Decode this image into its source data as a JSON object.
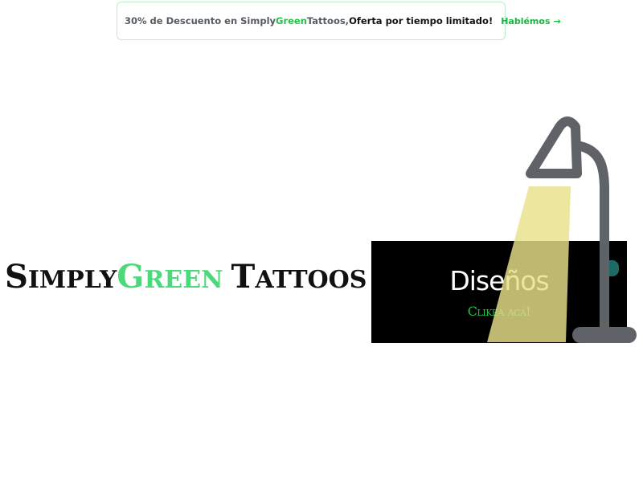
{
  "promo": {
    "text_part1": "30% de Descuento en Simply",
    "text_green": "Green",
    "text_part2": " Tattoos,",
    "text_bold": "Oferta por tiempo limitado!",
    "cta_label": "Hablémos",
    "cta_arrow": "→",
    "colors": {
      "border": "#b9ecc8",
      "green": "#26c048",
      "muted": "#555b61"
    }
  },
  "brand": {
    "simply_initial": "S",
    "simply_rest": "IMPLY",
    "green_initial": "G",
    "green_rest": "REEN",
    "tattoos_initial": "T",
    "tattoos_rest": "ATTOOS",
    "colors": {
      "dark": "#111111",
      "green": "#4cd97b"
    }
  },
  "designs": {
    "title": "Diseños",
    "subtitle": "Clikea acá!",
    "colors": {
      "background": "#000000",
      "title": "#ffffff",
      "subtitle": "#20c54a"
    }
  },
  "lamp": {
    "icon": "desk-lamp-icon",
    "colors": {
      "body": "#5f6368",
      "light": "#e8e08a",
      "accent": "#1d6b66"
    }
  }
}
